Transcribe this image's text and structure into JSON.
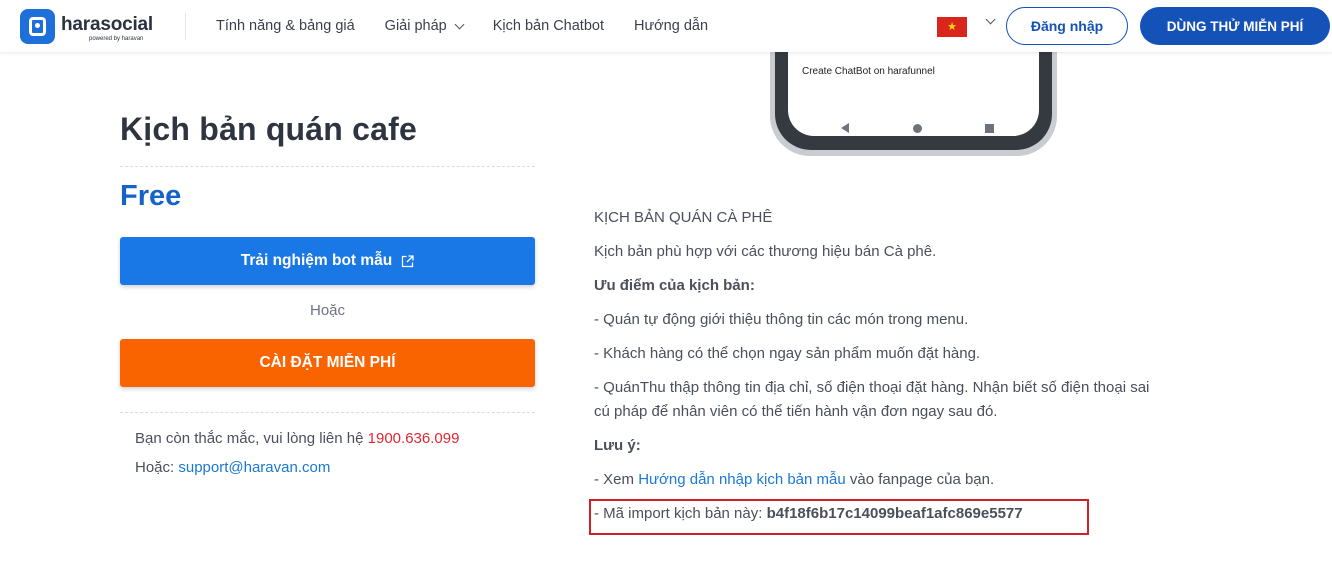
{
  "header": {
    "logo_name": "harasocial",
    "logo_powered": "powered by haravan",
    "nav": [
      {
        "label": "Tính năng & bảng giá",
        "has_dropdown": false
      },
      {
        "label": "Giải pháp",
        "has_dropdown": true
      },
      {
        "label": "Kịch bản Chatbot",
        "has_dropdown": false
      },
      {
        "label": "Hướng dẫn",
        "has_dropdown": false
      }
    ],
    "language_flag": "vietnam-flag-icon",
    "login_label": "Đăng nhập",
    "trial_label": "DÙNG THỬ MIỄN PHÍ"
  },
  "phone_preview": {
    "text": "Create ChatBot on harafunnel"
  },
  "left": {
    "title": "Kịch bản quán cafe",
    "price": "Free",
    "try_label": "Trải nghiệm bot mẫu",
    "or_label": "Hoặc",
    "install_label": "CÀI ĐẶT MIỄN PHÍ",
    "contact_text": "Bạn còn thắc mắc, vui lòng liên hệ",
    "contact_phone": "1900.636.099",
    "contact_or": "Hoặc:",
    "contact_email": "support@haravan.com"
  },
  "right": {
    "heading": "KỊCH BẢN QUÁN CÀ PHÊ",
    "description": "Kịch bản phù hợp với các thương hiệu bán Cà phê.",
    "advantages_label": "Ưu điểm của kịch bản:",
    "advantages": [
      "- Quán tự động giới thiệu thông tin các món trong menu.",
      "- Khách hàng có thể chọn ngay sản phẩm muốn đặt hàng.",
      "- QuánThu thập thông tin địa chỉ, số điện thoại đặt hàng. Nhận biết số điện thoại sai",
      "cú pháp để nhân viên có thể tiến hành vận đơn ngay sau đó."
    ],
    "note_label": "Lưu ý:",
    "guide_prefix": "- Xem",
    "guide_link": "Hướng dẫn nhập kịch bản mẫu",
    "guide_suffix": "vào fanpage của bạn.",
    "import_prefix": "- Mã import kịch bản này:",
    "import_code": "b4f18f6b17c14099beaf1afc869e5577"
  },
  "colors": {
    "brand_blue": "#1452b8",
    "button_blue": "#1a78e6",
    "button_orange": "#fa6400",
    "highlight_red": "#d21f25"
  }
}
